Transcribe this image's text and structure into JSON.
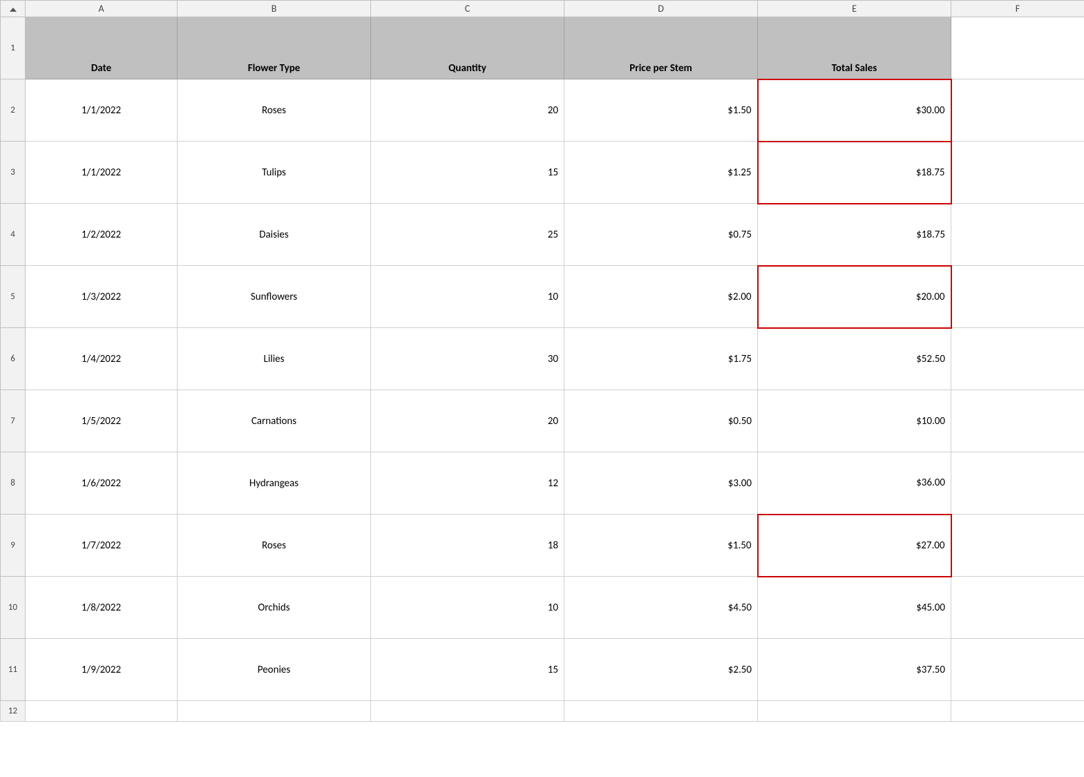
{
  "columns": {
    "indicator": "",
    "a": "A",
    "b": "B",
    "c": "C",
    "d": "D",
    "e": "E",
    "f": "F"
  },
  "header_row": {
    "row_num": "1",
    "col_a": "Date",
    "col_b": "Flower Type",
    "col_c": "Quantity",
    "col_d": "Price per Stem",
    "col_e": "Total Sales"
  },
  "rows": [
    {
      "row_num": "2",
      "date": "1/1/2022",
      "flower": "Roses",
      "quantity": "20",
      "price": "$1.50",
      "total": "$30.00",
      "highlight": true
    },
    {
      "row_num": "3",
      "date": "1/1/2022",
      "flower": "Tulips",
      "quantity": "15",
      "price": "$1.25",
      "total": "$18.75",
      "highlight": true
    },
    {
      "row_num": "4",
      "date": "1/2/2022",
      "flower": "Daisies",
      "quantity": "25",
      "price": "$0.75",
      "total": "$18.75",
      "highlight": false
    },
    {
      "row_num": "5",
      "date": "1/3/2022",
      "flower": "Sunflowers",
      "quantity": "10",
      "price": "$2.00",
      "total": "$20.00",
      "highlight": true
    },
    {
      "row_num": "6",
      "date": "1/4/2022",
      "flower": "Lilies",
      "quantity": "30",
      "price": "$1.75",
      "total": "$52.50",
      "highlight": false
    },
    {
      "row_num": "7",
      "date": "1/5/2022",
      "flower": "Carnations",
      "quantity": "20",
      "price": "$0.50",
      "total": "$10.00",
      "highlight": false
    },
    {
      "row_num": "8",
      "date": "1/6/2022",
      "flower": "Hydrangeas",
      "quantity": "12",
      "price": "$3.00",
      "total": "$36.00",
      "highlight": false
    },
    {
      "row_num": "9",
      "date": "1/7/2022",
      "flower": "Roses",
      "quantity": "18",
      "price": "$1.50",
      "total": "$27.00",
      "highlight": true
    },
    {
      "row_num": "10",
      "date": "1/8/2022",
      "flower": "Orchids",
      "quantity": "10",
      "price": "$4.50",
      "total": "$45.00",
      "highlight": false
    },
    {
      "row_num": "11",
      "date": "1/9/2022",
      "flower": "Peonies",
      "quantity": "15",
      "price": "$2.50",
      "total": "$37.50",
      "highlight": false
    }
  ],
  "empty_row": "12"
}
